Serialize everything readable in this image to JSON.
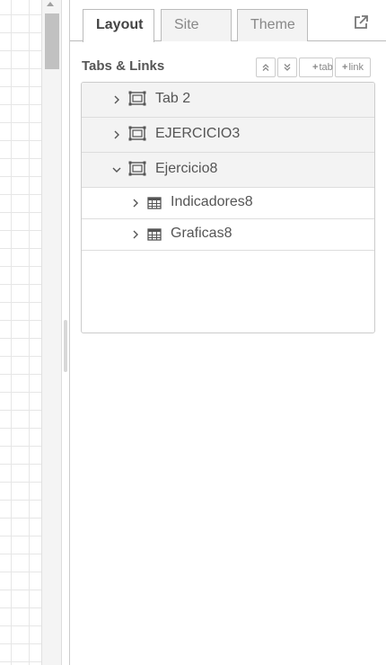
{
  "tabs": [
    {
      "label": "Layout",
      "active": true
    },
    {
      "label": "Site",
      "active": false
    },
    {
      "label": "Theme",
      "active": false
    }
  ],
  "popout_icon": "external-link-icon",
  "section": {
    "title": "Tabs & Links",
    "buttons": {
      "collapse_all": "chevrons-up-icon",
      "expand_all": "chevrons-down-icon",
      "add_tab": "tab",
      "add_link": "link"
    }
  },
  "tree": [
    {
      "type": "tab",
      "label": "Tab 2",
      "expanded": false,
      "icon": "tab-frame-icon"
    },
    {
      "type": "tab",
      "label": "EJERCICIO3",
      "expanded": false,
      "icon": "tab-frame-icon"
    },
    {
      "type": "tab",
      "label": "Ejercicio8",
      "expanded": true,
      "icon": "tab-frame-icon"
    },
    {
      "type": "group",
      "label": "Indicadores8",
      "expanded": false,
      "icon": "table-icon"
    },
    {
      "type": "group",
      "label": "Graficas8",
      "expanded": false,
      "icon": "table-icon"
    }
  ],
  "colors": {
    "panel_bg": "#ffffff",
    "tab_row_bg": "#f3f3f3",
    "border": "#cccccc",
    "text": "#555555"
  }
}
